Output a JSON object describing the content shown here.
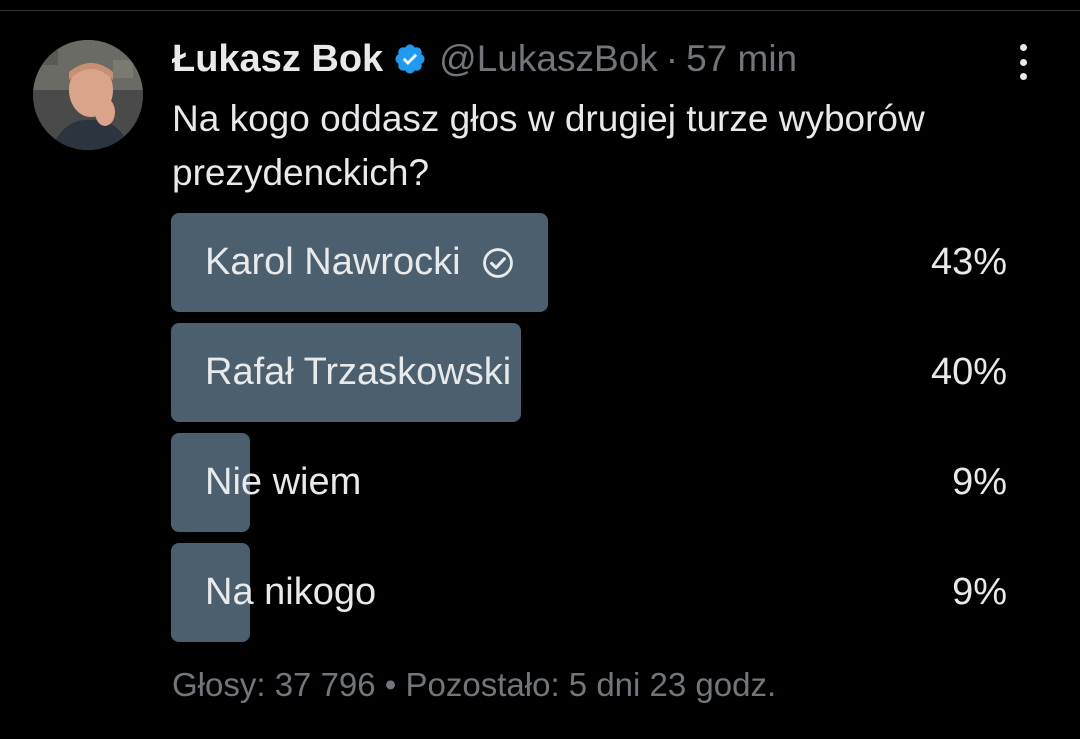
{
  "post": {
    "author_name": "Łukasz Bok",
    "handle": "@LukaszBok",
    "separator": "·",
    "time": "57 min",
    "text": "Na kogo oddasz głos w drugiej turze wyborów prezydenckich?",
    "verified_icon": "verified-badge-icon",
    "more_icon": "more-options-icon"
  },
  "poll": {
    "options": [
      {
        "label": "Karol Nawrocki",
        "percent_text": "43%",
        "percent": 43,
        "selected": true
      },
      {
        "label": "Rafał Trzaskowski",
        "percent_text": "40%",
        "percent": 40,
        "selected": false
      },
      {
        "label": "Nie wiem",
        "percent_text": "9%",
        "percent": 9,
        "selected": false
      },
      {
        "label": "Na nikogo",
        "percent_text": "9%",
        "percent": 9,
        "selected": false
      }
    ],
    "votes": "Głosy: 37 796",
    "footer_separator": "•",
    "remaining": "Pozostało: 5 dni 23 godz."
  },
  "colors": {
    "background": "#000000",
    "text": "#e7e9ea",
    "muted": "#71767b",
    "bar": "#4b5f6e",
    "verified": "#1d9bf0"
  }
}
